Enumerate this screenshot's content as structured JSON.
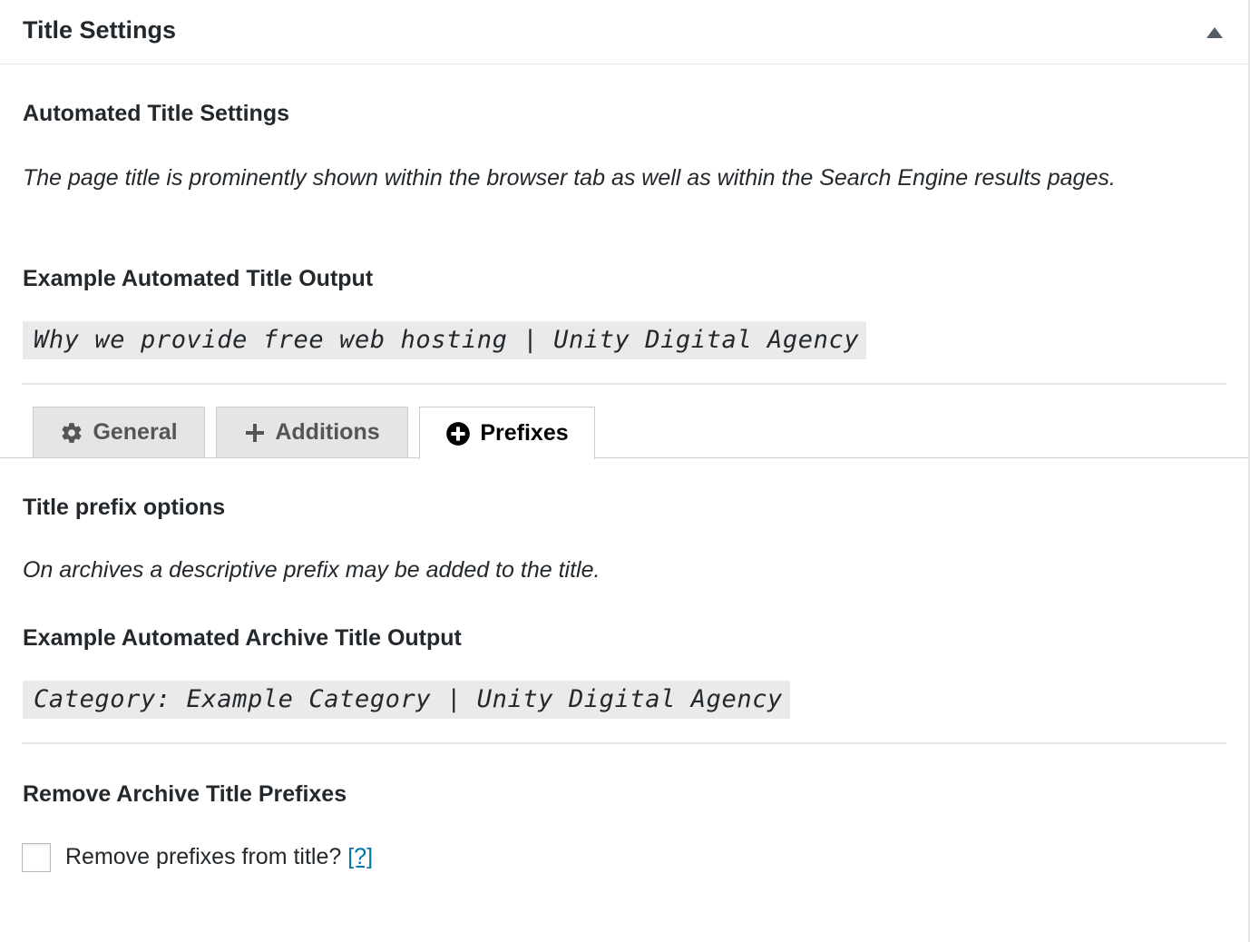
{
  "panel": {
    "title": "Title Settings",
    "toggle_icon": "triangle-up-icon"
  },
  "automated": {
    "heading": "Automated Title Settings",
    "description": "The page title is prominently shown within the browser tab as well as within the Search Engine results pages.",
    "example_heading": "Example Automated Title Output",
    "example_output": "Why we provide free web hosting | Unity Digital Agency"
  },
  "tabs": [
    {
      "label": "General",
      "icon": "gear-icon",
      "active": false
    },
    {
      "label": "Additions",
      "icon": "plus-icon",
      "active": false
    },
    {
      "label": "Prefixes",
      "icon": "plus-circle-icon",
      "active": true
    }
  ],
  "prefixes": {
    "heading": "Title prefix options",
    "description": "On archives a descriptive prefix may be added to the title.",
    "example_heading": "Example Automated Archive Title Output",
    "example_output": "Category: Example Category | Unity Digital Agency",
    "remove_heading": "Remove Archive Title Prefixes",
    "checkbox_label": "Remove prefixes from title?",
    "checkbox_checked": false,
    "help_link": "[?]"
  },
  "colors": {
    "link": "#0073aa",
    "code_bg": "#eaeaea",
    "tab_bg": "#e5e5e5"
  }
}
